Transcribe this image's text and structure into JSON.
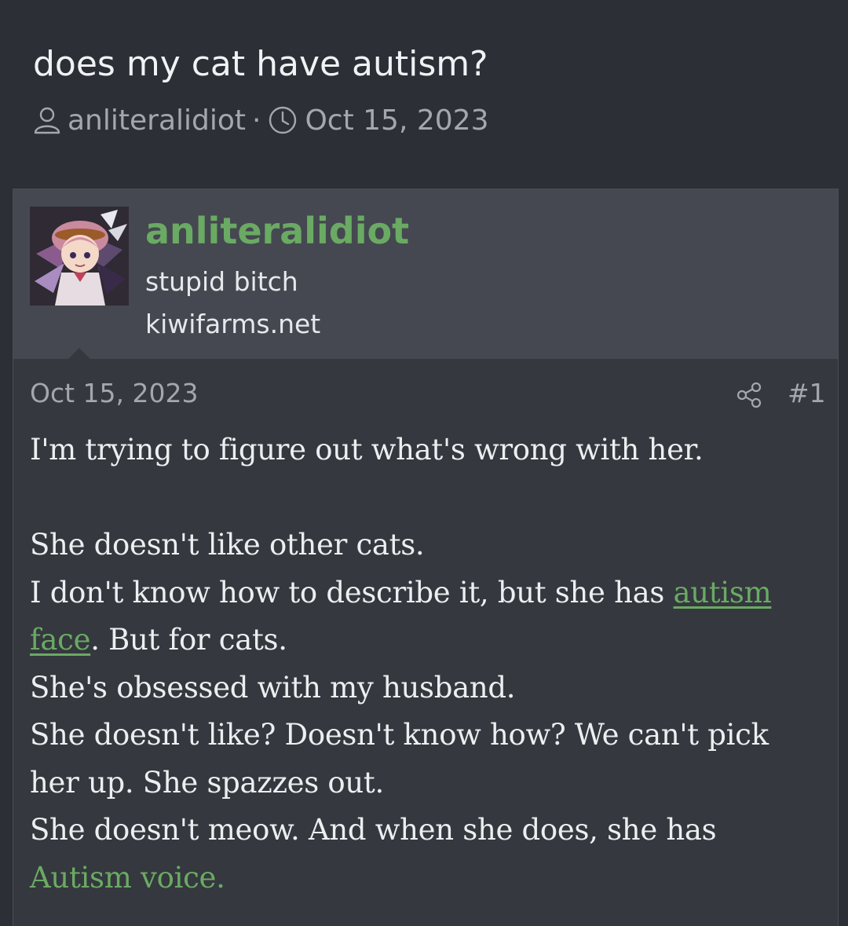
{
  "thread": {
    "title": "does my cat have autism?",
    "author": "anliteralidiot",
    "separator": "·",
    "date": "Oct 15, 2023"
  },
  "post": {
    "user": {
      "name": "anliteralidiot",
      "title": "stupid bitch",
      "site": "kiwifarms.net"
    },
    "date": "Oct 15, 2023",
    "number": "#1",
    "body": {
      "line1": "I'm trying to figure out what's wrong with her.",
      "line2": "She doesn't like other cats.",
      "line3_pre": "I don't know how to describe it, but she has ",
      "line3_link_a": "autism",
      "line3_link_b": "face",
      "line3_post": ". But for cats.",
      "line4": "She's obsessed with my husband.",
      "line5": "She doesn't like? Doesn't know how? We can't pick her up. She spazzes out.",
      "line6_pre": "She doesn't meow. And when she does, she has ",
      "line6_green": "Autism voice."
    }
  },
  "colors": {
    "accent": "#6aaa64",
    "background": "#2c2f36",
    "post_background": "#35383e",
    "user_block_background": "#454850",
    "muted_text": "#a3a7ae"
  },
  "icons": {
    "author": "user-icon",
    "date": "clock-icon",
    "share": "share-icon"
  }
}
